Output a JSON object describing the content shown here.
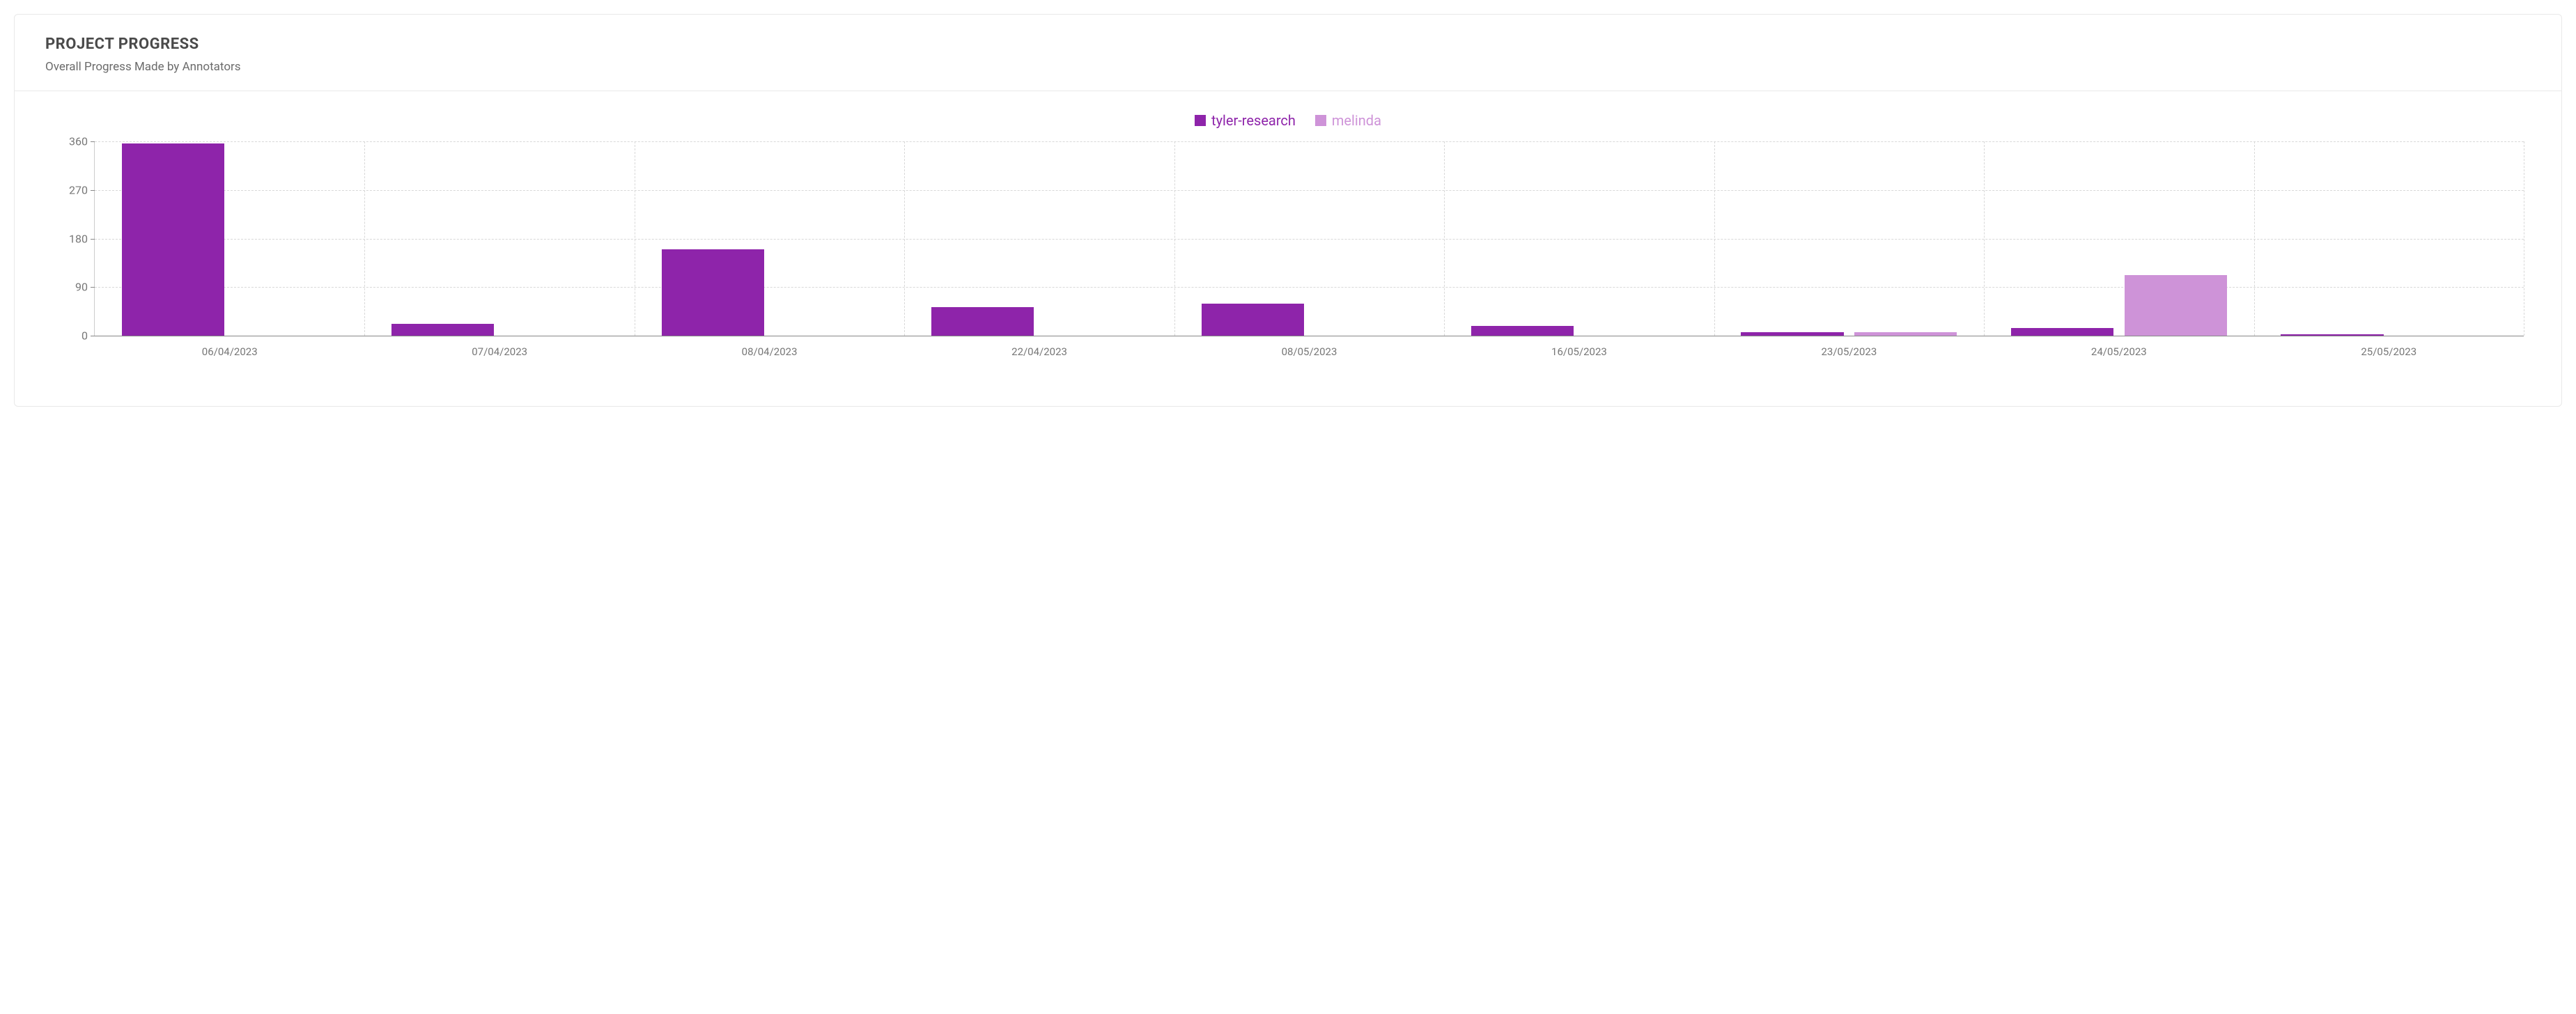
{
  "header": {
    "title": "PROJECT PROGRESS",
    "subtitle": "Overall Progress Made by Annotators"
  },
  "chart_data": {
    "type": "bar",
    "title": "",
    "xlabel": "",
    "ylabel": "",
    "ylim": [
      0,
      360
    ],
    "yticks": [
      0,
      90,
      180,
      270,
      360
    ],
    "categories": [
      "06/04/2023",
      "07/04/2023",
      "08/04/2023",
      "22/04/2023",
      "08/05/2023",
      "16/05/2023",
      "23/05/2023",
      "24/05/2023",
      "25/05/2023"
    ],
    "series": [
      {
        "name": "tyler-research",
        "color": "#8e24aa",
        "values": [
          356,
          22,
          160,
          53,
          60,
          18,
          6,
          14,
          3
        ]
      },
      {
        "name": "melinda",
        "color": "#ce93d8",
        "values": [
          0,
          0,
          0,
          0,
          0,
          0,
          7,
          112,
          0
        ]
      }
    ],
    "legend_position": "top"
  }
}
